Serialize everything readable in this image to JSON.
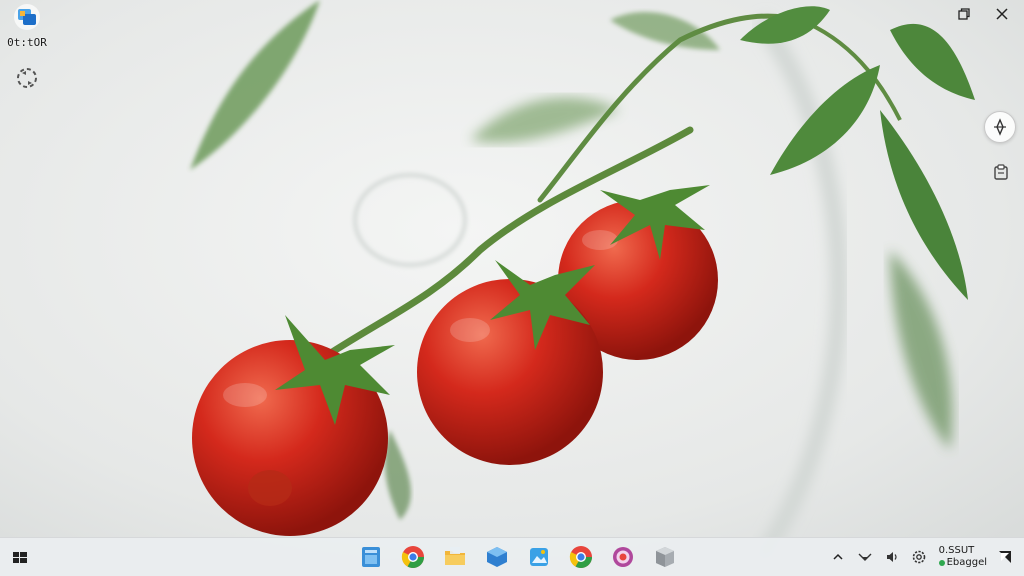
{
  "desktop": {
    "icons": [
      {
        "label": "0t:tOR",
        "icon": "app-window-icon"
      },
      {
        "label": "",
        "icon": "recycle-icon"
      }
    ]
  },
  "window_controls": {
    "restore_icon": "restore-icon",
    "close_icon": "close-icon"
  },
  "side_panel": {
    "buttons": [
      {
        "icon": "compass-icon"
      },
      {
        "icon": "clipboard-icon"
      }
    ]
  },
  "taskbar": {
    "start_icon": "start-icon",
    "apps": [
      {
        "icon": "files-icon",
        "color": "#3a8fd8"
      },
      {
        "icon": "chrome-icon",
        "color": "#e8453c"
      },
      {
        "icon": "folder-icon",
        "color": "#f2b63a"
      },
      {
        "icon": "box-icon",
        "color": "#2f7fd0"
      },
      {
        "icon": "photos-icon",
        "color": "#3aa1e6"
      },
      {
        "icon": "chrome-icon",
        "color": "#e8453c"
      },
      {
        "icon": "lens-icon",
        "color": "#b0489c"
      },
      {
        "icon": "cube-icon",
        "color": "#8f9499"
      }
    ],
    "tray": {
      "icons": [
        "chevron-up-icon",
        "network-icon",
        "volume-icon",
        "settings-icon"
      ],
      "time": "0.SSUT",
      "date": "Ebaggel",
      "notification_icon": "notification-icon"
    }
  },
  "colors": {
    "tomato": "#c9231a",
    "leaf": "#4d8a3f",
    "taskbar": "#ebeef0"
  }
}
